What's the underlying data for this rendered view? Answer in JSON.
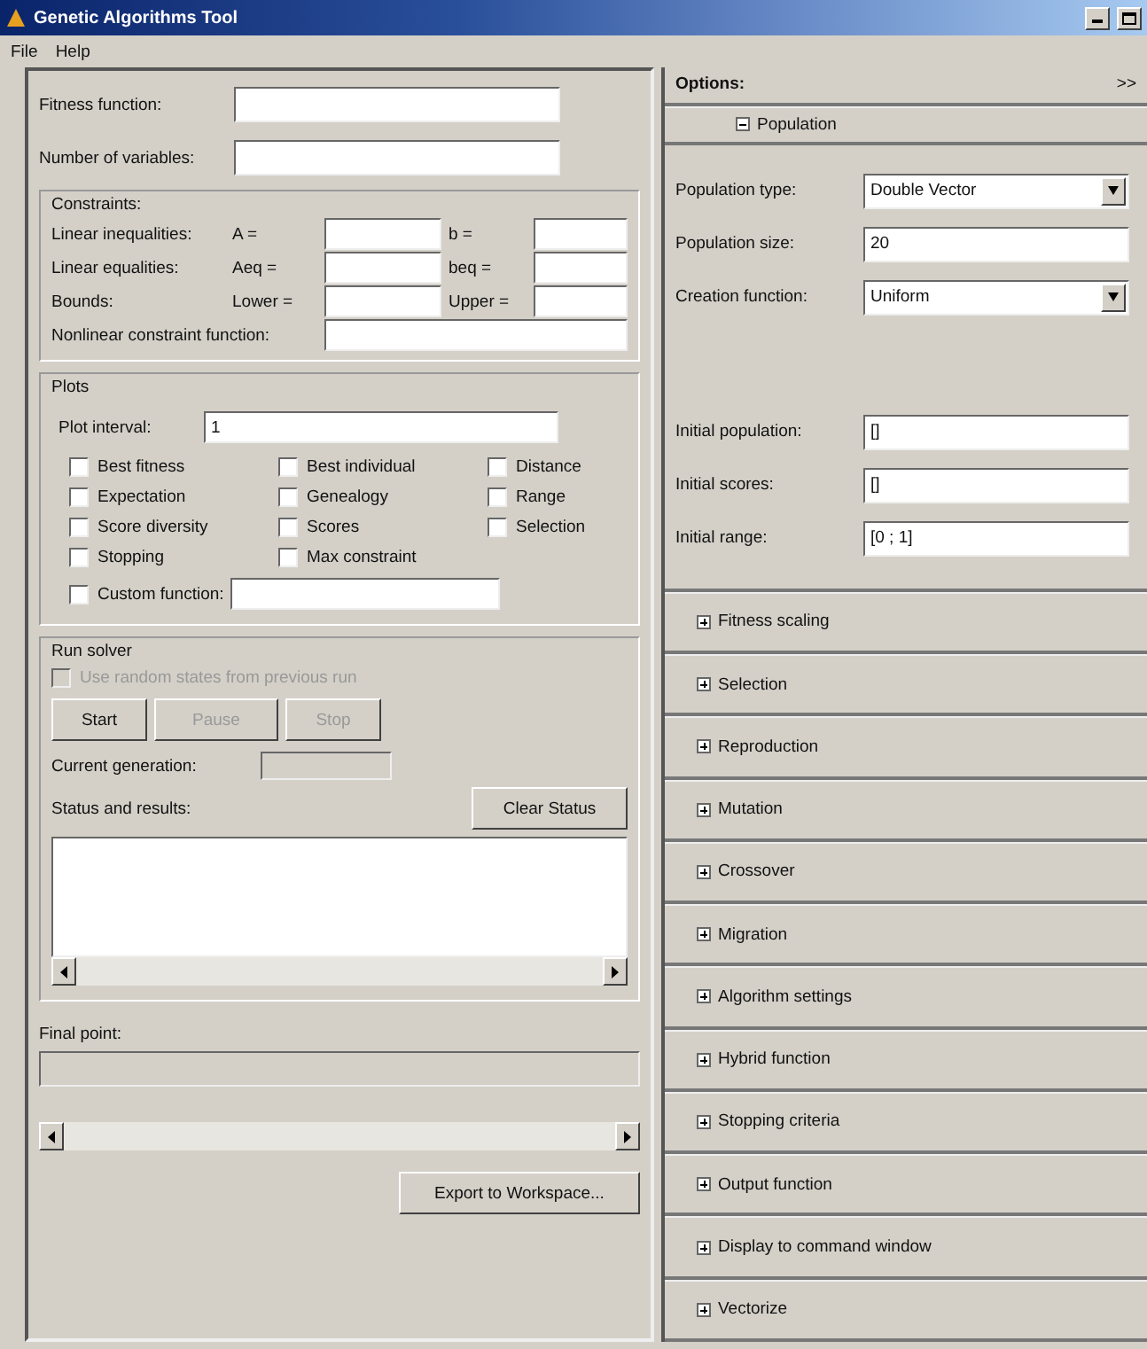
{
  "window": {
    "title": "Genetic Algorithms Tool"
  },
  "menu": [
    "File",
    "Help"
  ],
  "problem": {
    "fields": [
      {
        "label": "Fitness function:"
      },
      {
        "label": "Number of variables:"
      }
    ]
  },
  "constraints": {
    "title": "Constraints:",
    "rows": [
      {
        "label": "Linear inequalities:",
        "left": "A =",
        "right": "b ="
      },
      {
        "label": "Linear equalities:",
        "left": "Aeq =",
        "right": "beq ="
      },
      {
        "label": "Bounds:",
        "left": "Lower =",
        "right": "Upper ="
      }
    ],
    "nonlinear": {
      "label": "Nonlinear constraint function:"
    }
  },
  "plots": {
    "title": "Plots",
    "interval": {
      "label": "Plot interval:",
      "value": "1"
    },
    "checkboxes": [
      {
        "label": "Best fitness",
        "checked": false
      },
      {
        "label": "Best individual",
        "checked": false
      },
      {
        "label": "Distance",
        "checked": false
      },
      {
        "label": "Expectation",
        "checked": false
      },
      {
        "label": "Genealogy",
        "checked": false
      },
      {
        "label": "Range",
        "checked": false
      },
      {
        "label": "Score diversity",
        "checked": false
      },
      {
        "label": "Scores",
        "checked": false
      },
      {
        "label": "Selection",
        "checked": false
      },
      {
        "label": "Stopping",
        "checked": false
      },
      {
        "label": "Max constraint",
        "checked": false
      }
    ],
    "custom": {
      "label": "Custom function:",
      "checked": false
    }
  },
  "run_solver": {
    "title": "Run solver",
    "use_random": {
      "label": "Use random states from previous run",
      "checked": false,
      "disabled": true
    },
    "buttons": [
      {
        "label": "Start",
        "disabled": false
      },
      {
        "label": "Pause",
        "disabled": true
      },
      {
        "label": "Stop",
        "disabled": true
      }
    ],
    "current_generation": {
      "label": "Current generation:"
    },
    "status": {
      "label": "Status and results:"
    },
    "clear_button": "Clear Status"
  },
  "final_point": {
    "label": "Final point:"
  },
  "export_button": "Export to Workspace...",
  "options": {
    "title": "Options:",
    "collapse_glyph": ">>",
    "sections": [
      {
        "label": "Population",
        "expanded": true,
        "fields": [
          {
            "kind": "select",
            "label": "Population type:",
            "value": "Double Vector"
          },
          {
            "kind": "text",
            "label": "Population size:",
            "value": "20"
          },
          {
            "kind": "select",
            "label": "Creation function:",
            "value": "Uniform"
          },
          {
            "kind": "gap"
          },
          {
            "kind": "text",
            "label": "Initial population:",
            "value": "[]"
          },
          {
            "kind": "text",
            "label": "Initial scores:",
            "value": "[]"
          },
          {
            "kind": "text",
            "label": "Initial range:",
            "value": "[0 ; 1]"
          }
        ]
      },
      {
        "label": "Fitness scaling",
        "expanded": false
      },
      {
        "label": "Selection",
        "expanded": false
      },
      {
        "label": "Reproduction",
        "expanded": false
      },
      {
        "label": "Mutation",
        "expanded": false
      },
      {
        "label": "Crossover",
        "expanded": false
      },
      {
        "label": "Migration",
        "expanded": false
      },
      {
        "label": "Algorithm settings",
        "expanded": false
      },
      {
        "label": "Hybrid function",
        "expanded": false
      },
      {
        "label": "Stopping criteria",
        "expanded": false
      },
      {
        "label": "Output function",
        "expanded": false
      },
      {
        "label": "Display to command window",
        "expanded": false
      },
      {
        "label": "Vectorize",
        "expanded": false
      }
    ]
  }
}
